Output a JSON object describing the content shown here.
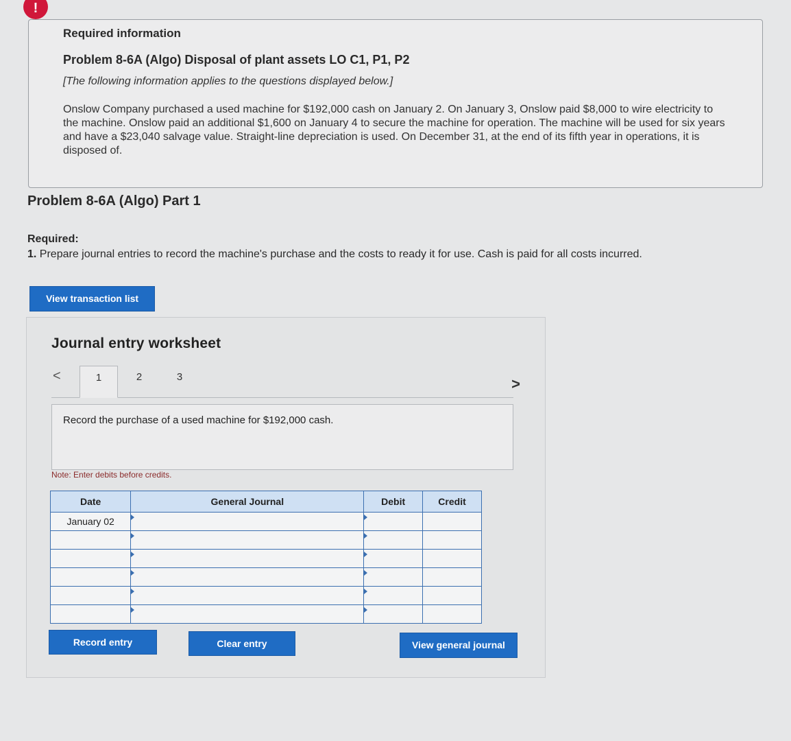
{
  "info_box": {
    "alert_glyph": "!",
    "heading": "Required information",
    "problem_title": "Problem 8-6A (Algo) Disposal of plant assets LO C1, P1, P2",
    "italic_note": "[The following information applies to the questions displayed below.]",
    "paragraph": "Onslow Company purchased a used machine for $192,000 cash on January 2. On January 3, Onslow paid $8,000 to wire electricity to the machine. Onslow paid an additional $1,600 on January 4 to secure the machine for operation. The machine will be used for six years and have a $23,040 salvage value. Straight-line depreciation is used. On December 31, at the end of its fifth year in operations, it is disposed of."
  },
  "part": {
    "title": "Problem 8-6A (Algo) Part 1",
    "required_label": "Required:",
    "item_number": "1.",
    "item_text": "Prepare journal entries to record the machine's purchase and the costs to ready it for use. Cash is paid for all costs incurred."
  },
  "buttons": {
    "view_transaction_list": "View transaction list",
    "record_entry": "Record entry",
    "clear_entry": "Clear entry",
    "view_general_journal": "View general journal"
  },
  "worksheet": {
    "title": "Journal entry worksheet",
    "prev_glyph": "<",
    "next_glyph": ">",
    "tabs": [
      "1",
      "2",
      "3"
    ],
    "active_tab": "1",
    "description": "Record the purchase of a used machine for $192,000 cash.",
    "note": "Note: Enter debits before credits."
  },
  "journal_table": {
    "headers": {
      "date": "Date",
      "general_journal": "General Journal",
      "debit": "Debit",
      "credit": "Credit"
    },
    "rows": [
      {
        "date": "January 02",
        "account": "",
        "debit": "",
        "credit": ""
      },
      {
        "date": "",
        "account": "",
        "debit": "",
        "credit": ""
      },
      {
        "date": "",
        "account": "",
        "debit": "",
        "credit": ""
      },
      {
        "date": "",
        "account": "",
        "debit": "",
        "credit": ""
      },
      {
        "date": "",
        "account": "",
        "debit": "",
        "credit": ""
      },
      {
        "date": "",
        "account": "",
        "debit": "",
        "credit": ""
      }
    ]
  },
  "colors": {
    "primary_button": "#1f6cc4",
    "table_header": "#cfe0f3",
    "table_border": "#3b6fb0",
    "alert": "#d0173a"
  }
}
